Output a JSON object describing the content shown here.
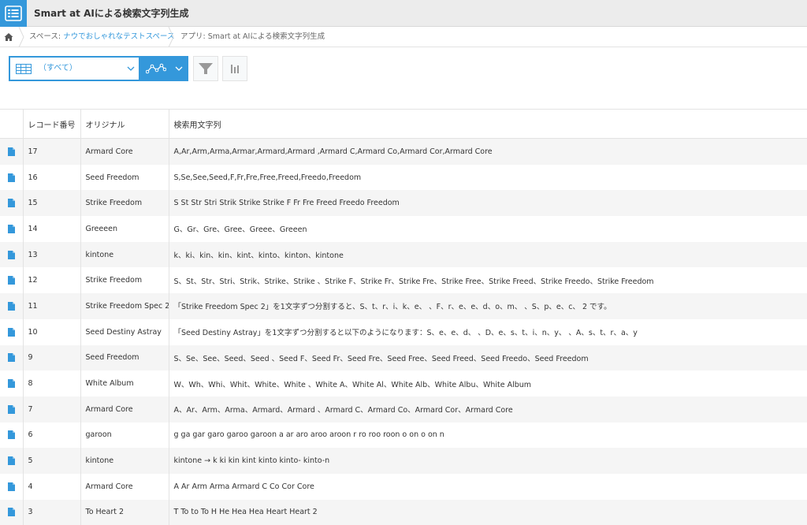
{
  "app": {
    "title": "Smart at AIによる検索文字列生成"
  },
  "breadcrumb": {
    "space_prefix": "スペース: ",
    "space_name": "ナウでおしゃれなテストスペース",
    "app_prefix": "アプリ: ",
    "app_name": "Smart at AIによる検索文字列生成"
  },
  "toolbar": {
    "view_label": "（すべて）"
  },
  "table": {
    "headers": [
      "レコード番号",
      "オリジナル",
      "検索用文字列"
    ],
    "rows": [
      {
        "id": "17",
        "original": "Armard Core",
        "search": "A,Ar,Arm,Arma,Armar,Armard,Armard ,Armard C,Armard Co,Armard Cor,Armard Core"
      },
      {
        "id": "16",
        "original": "Seed Freedom",
        "search": "S,Se,See,Seed,F,Fr,Fre,Free,Freed,Freedo,Freedom"
      },
      {
        "id": "15",
        "original": "Strike Freedom",
        "search": "S St Str Stri Strik Strike Strike F Fr Fre Freed Freedo Freedom"
      },
      {
        "id": "14",
        "original": "Greeeen",
        "search": "G、Gr、Gre、Gree、Greee、Greeen"
      },
      {
        "id": "13",
        "original": "kintone",
        "search": "k、ki、kin、kin、kint、kinto、kinton、kintone"
      },
      {
        "id": "12",
        "original": "Strike Freedom",
        "search": "S、St、Str、Stri、Strik、Strike、Strike 、Strike F、Strike Fr、Strike Fre、Strike Free、Strike Freed、Strike Freedo、Strike Freedom"
      },
      {
        "id": "11",
        "original": "Strike Freedom Spec 2",
        "search": "「Strike Freedom Spec 2」を1文字ずつ分割すると、S、t、r、i、k、e、 、F、r、e、e、d、o、m、 、S、p、e、c、 2 です。"
      },
      {
        "id": "10",
        "original": "Seed Destiny Astray",
        "search": "「Seed Destiny Astray」を1文字ずつ分割すると以下のようになります：S、e、e、d、 、D、e、s、t、i、n、y、 、A、s、t、r、a、y"
      },
      {
        "id": "9",
        "original": "Seed Freedom",
        "search": "S、Se、See、Seed、Seed 、Seed F、Seed Fr、Seed Fre、Seed Free、Seed Freed、Seed Freedo、Seed Freedom"
      },
      {
        "id": "8",
        "original": "White Album",
        "search": "W、Wh、Whi、Whit、White、White 、White A、White Al、White Alb、White Albu、White Album"
      },
      {
        "id": "7",
        "original": "Armard Core",
        "search": "A、Ar、Arm、Arma、Armard、Armard 、Armard C、Armard Co、Armard Cor、Armard Core"
      },
      {
        "id": "6",
        "original": "garoon",
        "search": "g ga gar garo garoo garoon a ar aro aroo aroon r ro roo roon o on o on n"
      },
      {
        "id": "5",
        "original": "kintone",
        "search": "kintone → k ki kin kint kinto kinto- kinto-n"
      },
      {
        "id": "4",
        "original": "Armard Core",
        "search": "A Ar Arm Arma Armard C Co Cor Core"
      },
      {
        "id": "3",
        "original": "To Heart 2",
        "search": "T To to To H He Hea Hea Heart Heart 2"
      }
    ]
  },
  "colors": {
    "accent": "#3498db",
    "header_bg": "#ececec",
    "row_alt": "#f5f5f5"
  },
  "icons": {
    "app": "list-icon",
    "home": "home-icon",
    "view": "table-view-icon",
    "graph": "graph-icon",
    "filter": "filter-icon",
    "chart": "bar-chart-icon",
    "record": "document-icon"
  }
}
